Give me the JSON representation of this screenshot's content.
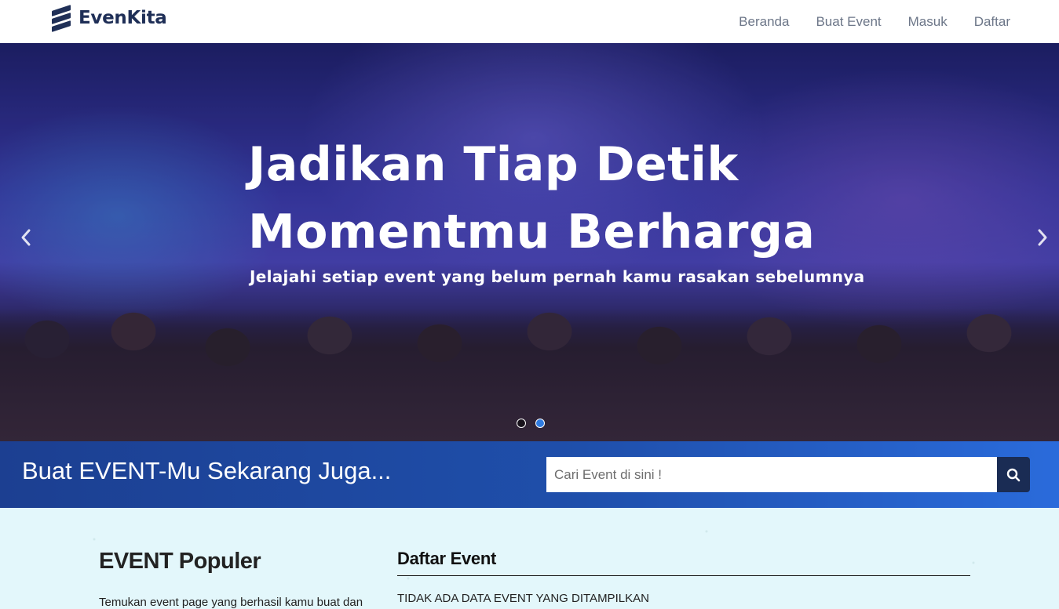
{
  "brand": {
    "name": "EvenKita"
  },
  "nav": {
    "items": [
      {
        "label": "Beranda"
      },
      {
        "label": "Buat Event"
      },
      {
        "label": "Masuk"
      },
      {
        "label": "Daftar"
      }
    ]
  },
  "hero": {
    "title_line1": "Jadikan Tiap Detik",
    "title_line2": "Momentmu Berharga",
    "subtitle": "Jelajahi setiap event yang belum pernah kamu rasakan sebelumnya",
    "prev_icon": "chevron-left-icon",
    "next_icon": "chevron-right-icon",
    "slides_count": 2,
    "active_slide": 2
  },
  "cta": {
    "text": "Buat EVENT-Mu Sekarang Juga...",
    "search_placeholder": "Cari Event di sini !",
    "search_icon": "search-icon"
  },
  "populer": {
    "title": "EVENT Populer",
    "description": "Temukan event page yang berhasil kamu buat dan"
  },
  "daftar": {
    "title": "Daftar Event",
    "empty_message": "TIDAK ADA DATA EVENT YANG DITAMPILKAN"
  },
  "colors": {
    "brand": "#1f2f57",
    "nav_text": "#6c7688",
    "cta_bar_start": "#1c3f91",
    "cta_bar_end": "#2a6bdb",
    "search_button": "#1a2c54",
    "content_bg": "#e3f7fb",
    "active_dot": "#2f7be0"
  }
}
